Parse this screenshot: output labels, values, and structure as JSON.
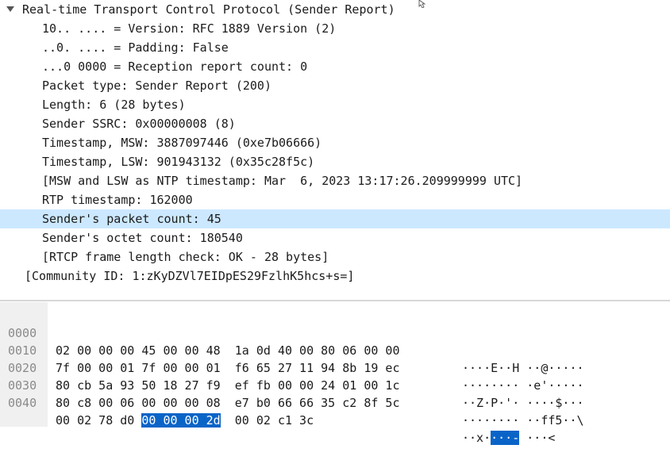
{
  "tree": {
    "rows": [
      {
        "text": "Real-time Transport Control Protocol (Sender Report)"
      },
      {
        "text": "10.. .... = Version: RFC 1889 Version (2)"
      },
      {
        "text": "..0. .... = Padding: False"
      },
      {
        "text": "...0 0000 = Reception report count: 0"
      },
      {
        "text": "Packet type: Sender Report (200)"
      },
      {
        "text": "Length: 6 (28 bytes)"
      },
      {
        "text": "Sender SSRC: 0x00000008 (8)"
      },
      {
        "text": "Timestamp, MSW: 3887097446 (0xe7b06666)"
      },
      {
        "text": "Timestamp, LSW: 901943132 (0x35c28f5c)"
      },
      {
        "text": "[MSW and LSW as NTP timestamp: Mar  6, 2023 13:17:26.209999999 UTC]"
      },
      {
        "text": "RTP timestamp: 162000"
      },
      {
        "text": "Sender's packet count: 45"
      },
      {
        "text": "Sender's octet count: 180540"
      },
      {
        "text": "[RTCP frame length check: OK - 28 bytes]"
      },
      {
        "text": "[Community ID: 1:zKyDZVl7EIDpES29FzlhK5hcs+s=]"
      }
    ]
  },
  "hex": {
    "rows": [
      {
        "offset": "0000",
        "bytes_pre": "02 00 00 00 45 00 00 48  1a 0d 40 00 80 06 00 00",
        "bytes_hl": "",
        "bytes_post": "",
        "ascii_pre": "····E··H ··@·····",
        "ascii_hl": "",
        "ascii_post": ""
      },
      {
        "offset": "0010",
        "bytes_pre": "7f 00 00 01 7f 00 00 01  f6 65 27 11 94 8b 19 ec",
        "bytes_hl": "",
        "bytes_post": "",
        "ascii_pre": "········ ·e'·····",
        "ascii_hl": "",
        "ascii_post": ""
      },
      {
        "offset": "0020",
        "bytes_pre": "80 cb 5a 93 50 18 27 f9  ef fb 00 00 24 01 00 1c",
        "bytes_hl": "",
        "bytes_post": "",
        "ascii_pre": "··Z·P·'· ····$···",
        "ascii_hl": "",
        "ascii_post": ""
      },
      {
        "offset": "0030",
        "bytes_pre": "80 c8 00 06 00 00 00 08  e7 b0 66 66 35 c2 8f 5c",
        "bytes_hl": "",
        "bytes_post": "",
        "ascii_pre": "········ ··ff5··\\",
        "ascii_hl": "",
        "ascii_post": ""
      },
      {
        "offset": "0040",
        "bytes_pre": "00 02 78 d0 ",
        "bytes_hl": "00 00 00 2d",
        "bytes_post": "  00 02 c1 3c",
        "ascii_pre": "··x·",
        "ascii_hl": "···-",
        "ascii_post": " ···<"
      }
    ]
  }
}
